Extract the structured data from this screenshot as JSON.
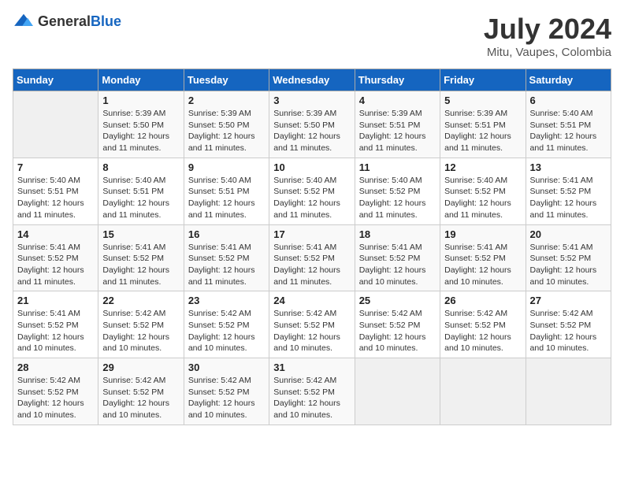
{
  "header": {
    "logo_general": "General",
    "logo_blue": "Blue",
    "month_year": "July 2024",
    "location": "Mitu, Vaupes, Colombia"
  },
  "days_of_week": [
    "Sunday",
    "Monday",
    "Tuesday",
    "Wednesday",
    "Thursday",
    "Friday",
    "Saturday"
  ],
  "weeks": [
    [
      {
        "day": "",
        "info": ""
      },
      {
        "day": "1",
        "info": "Sunrise: 5:39 AM\nSunset: 5:50 PM\nDaylight: 12 hours\nand 11 minutes."
      },
      {
        "day": "2",
        "info": "Sunrise: 5:39 AM\nSunset: 5:50 PM\nDaylight: 12 hours\nand 11 minutes."
      },
      {
        "day": "3",
        "info": "Sunrise: 5:39 AM\nSunset: 5:50 PM\nDaylight: 12 hours\nand 11 minutes."
      },
      {
        "day": "4",
        "info": "Sunrise: 5:39 AM\nSunset: 5:51 PM\nDaylight: 12 hours\nand 11 minutes."
      },
      {
        "day": "5",
        "info": "Sunrise: 5:39 AM\nSunset: 5:51 PM\nDaylight: 12 hours\nand 11 minutes."
      },
      {
        "day": "6",
        "info": "Sunrise: 5:40 AM\nSunset: 5:51 PM\nDaylight: 12 hours\nand 11 minutes."
      }
    ],
    [
      {
        "day": "7",
        "info": "Sunrise: 5:40 AM\nSunset: 5:51 PM\nDaylight: 12 hours\nand 11 minutes."
      },
      {
        "day": "8",
        "info": "Sunrise: 5:40 AM\nSunset: 5:51 PM\nDaylight: 12 hours\nand 11 minutes."
      },
      {
        "day": "9",
        "info": "Sunrise: 5:40 AM\nSunset: 5:51 PM\nDaylight: 12 hours\nand 11 minutes."
      },
      {
        "day": "10",
        "info": "Sunrise: 5:40 AM\nSunset: 5:52 PM\nDaylight: 12 hours\nand 11 minutes."
      },
      {
        "day": "11",
        "info": "Sunrise: 5:40 AM\nSunset: 5:52 PM\nDaylight: 12 hours\nand 11 minutes."
      },
      {
        "day": "12",
        "info": "Sunrise: 5:40 AM\nSunset: 5:52 PM\nDaylight: 12 hours\nand 11 minutes."
      },
      {
        "day": "13",
        "info": "Sunrise: 5:41 AM\nSunset: 5:52 PM\nDaylight: 12 hours\nand 11 minutes."
      }
    ],
    [
      {
        "day": "14",
        "info": "Sunrise: 5:41 AM\nSunset: 5:52 PM\nDaylight: 12 hours\nand 11 minutes."
      },
      {
        "day": "15",
        "info": "Sunrise: 5:41 AM\nSunset: 5:52 PM\nDaylight: 12 hours\nand 11 minutes."
      },
      {
        "day": "16",
        "info": "Sunrise: 5:41 AM\nSunset: 5:52 PM\nDaylight: 12 hours\nand 11 minutes."
      },
      {
        "day": "17",
        "info": "Sunrise: 5:41 AM\nSunset: 5:52 PM\nDaylight: 12 hours\nand 11 minutes."
      },
      {
        "day": "18",
        "info": "Sunrise: 5:41 AM\nSunset: 5:52 PM\nDaylight: 12 hours\nand 10 minutes."
      },
      {
        "day": "19",
        "info": "Sunrise: 5:41 AM\nSunset: 5:52 PM\nDaylight: 12 hours\nand 10 minutes."
      },
      {
        "day": "20",
        "info": "Sunrise: 5:41 AM\nSunset: 5:52 PM\nDaylight: 12 hours\nand 10 minutes."
      }
    ],
    [
      {
        "day": "21",
        "info": "Sunrise: 5:41 AM\nSunset: 5:52 PM\nDaylight: 12 hours\nand 10 minutes."
      },
      {
        "day": "22",
        "info": "Sunrise: 5:42 AM\nSunset: 5:52 PM\nDaylight: 12 hours\nand 10 minutes."
      },
      {
        "day": "23",
        "info": "Sunrise: 5:42 AM\nSunset: 5:52 PM\nDaylight: 12 hours\nand 10 minutes."
      },
      {
        "day": "24",
        "info": "Sunrise: 5:42 AM\nSunset: 5:52 PM\nDaylight: 12 hours\nand 10 minutes."
      },
      {
        "day": "25",
        "info": "Sunrise: 5:42 AM\nSunset: 5:52 PM\nDaylight: 12 hours\nand 10 minutes."
      },
      {
        "day": "26",
        "info": "Sunrise: 5:42 AM\nSunset: 5:52 PM\nDaylight: 12 hours\nand 10 minutes."
      },
      {
        "day": "27",
        "info": "Sunrise: 5:42 AM\nSunset: 5:52 PM\nDaylight: 12 hours\nand 10 minutes."
      }
    ],
    [
      {
        "day": "28",
        "info": "Sunrise: 5:42 AM\nSunset: 5:52 PM\nDaylight: 12 hours\nand 10 minutes."
      },
      {
        "day": "29",
        "info": "Sunrise: 5:42 AM\nSunset: 5:52 PM\nDaylight: 12 hours\nand 10 minutes."
      },
      {
        "day": "30",
        "info": "Sunrise: 5:42 AM\nSunset: 5:52 PM\nDaylight: 12 hours\nand 10 minutes."
      },
      {
        "day": "31",
        "info": "Sunrise: 5:42 AM\nSunset: 5:52 PM\nDaylight: 12 hours\nand 10 minutes."
      },
      {
        "day": "",
        "info": ""
      },
      {
        "day": "",
        "info": ""
      },
      {
        "day": "",
        "info": ""
      }
    ]
  ]
}
